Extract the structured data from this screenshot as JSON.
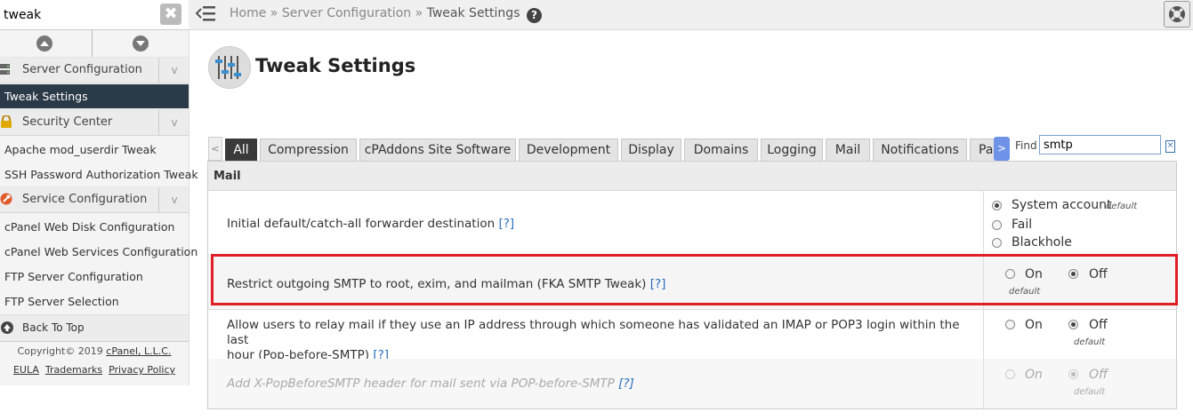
{
  "search": {
    "value": "tweak",
    "clear_glyph": "✖"
  },
  "breadcrumb": {
    "home": "Home",
    "sep": "»",
    "parent": "Server Configuration",
    "current": "Tweak Settings",
    "help": "?"
  },
  "sidebar": {
    "sections": [
      {
        "label": "Server Configuration",
        "chevron": "v",
        "icon": "server-icon"
      },
      {
        "label": "Security Center",
        "chevron": "v",
        "icon": "lock-icon"
      },
      {
        "label": "Service Configuration",
        "chevron": "v",
        "icon": "wrench-icon"
      }
    ],
    "active_item": "Tweak Settings",
    "security_items": [
      "Apache mod_userdir Tweak",
      "SSH Password Authorization Tweak"
    ],
    "service_items": [
      "cPanel Web Disk Configuration",
      "cPanel Web Services Configuration",
      "FTP Server Configuration",
      "FTP Server Selection"
    ],
    "back_to_top": "Back To Top",
    "copyright": "Copyright© 2019 ",
    "company": "cPanel, L.L.C.",
    "footer_links": [
      "EULA",
      "Trademarks",
      "Privacy Policy"
    ]
  },
  "page": {
    "title": "Tweak Settings"
  },
  "tabs": {
    "prev": "<",
    "next": ">",
    "items": [
      "All",
      "Compression",
      "cPAddons Site Software",
      "Development",
      "Display",
      "Domains",
      "Logging",
      "Mail",
      "Notifications",
      "Pa"
    ],
    "active": "All"
  },
  "find": {
    "label": "Find",
    "value": "smtp",
    "clear": "×"
  },
  "table": {
    "group": "Mail",
    "help_link": "[?]",
    "rows": [
      {
        "name": "Initial default/catch-all forwarder destination",
        "options": [
          "System account",
          "Fail",
          "Blackhole"
        ],
        "selected": 0,
        "default_note": "default"
      },
      {
        "name": "Restrict outgoing SMTP to root, exim, and mailman (FKA SMTP Tweak)",
        "options": [
          "On",
          "Off"
        ],
        "selected": 1,
        "default_note": "default"
      },
      {
        "name_line1": "Allow users to relay mail if they use an IP address through which someone has validated an IMAP or POP3 login within the last",
        "name_line2": "hour (Pop-before-SMTP)",
        "options": [
          "On",
          "Off"
        ],
        "selected": 1,
        "default_note": "default"
      },
      {
        "name": "Add X-PopBeforeSMTP header for mail sent via POP-before-SMTP",
        "options": [
          "On",
          "Off"
        ],
        "selected": 1,
        "default_note": "default",
        "disabled": true
      }
    ]
  },
  "colors": {
    "active_nav": "#2b3a48",
    "highlight": "#e01e26",
    "link": "#2a6ebb",
    "next_tab": "#6e92e8"
  }
}
